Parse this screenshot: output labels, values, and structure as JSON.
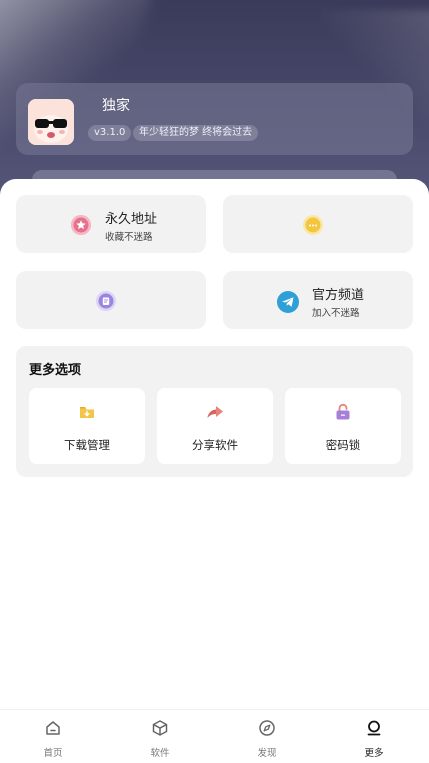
{
  "header": {
    "app_title": "独家",
    "version": "v3.1.0",
    "slogan": "年少轻狂的梦 终将会过去"
  },
  "quick_links": [
    {
      "title": "永久地址",
      "subtitle": "收藏不迷路",
      "icon": "star-icon",
      "color": "#e8708a"
    },
    {
      "title": "",
      "subtitle": "",
      "icon": "chat-bubble-icon",
      "color": "#f3c640"
    },
    {
      "title": "",
      "subtitle": "",
      "icon": "document-icon",
      "color": "#9a86e0"
    },
    {
      "title": "官方频道",
      "subtitle": "加入不迷路",
      "icon": "telegram-icon",
      "color": "#2f9fd8"
    }
  ],
  "more_options": {
    "title": "更多选项",
    "items": [
      {
        "label": "下载管理",
        "icon": "download-folder-icon",
        "color": "#f2c64a"
      },
      {
        "label": "分享软件",
        "icon": "share-arrow-icon",
        "color": "#e9837a"
      },
      {
        "label": "密码锁",
        "icon": "lock-icon",
        "color": "#a77fd8"
      }
    ]
  },
  "bottom_nav": {
    "items": [
      {
        "label": "首页",
        "icon": "home-icon"
      },
      {
        "label": "软件",
        "icon": "box-icon"
      },
      {
        "label": "发现",
        "icon": "compass-icon"
      },
      {
        "label": "更多",
        "icon": "user-icon"
      }
    ],
    "active_index": 3
  }
}
